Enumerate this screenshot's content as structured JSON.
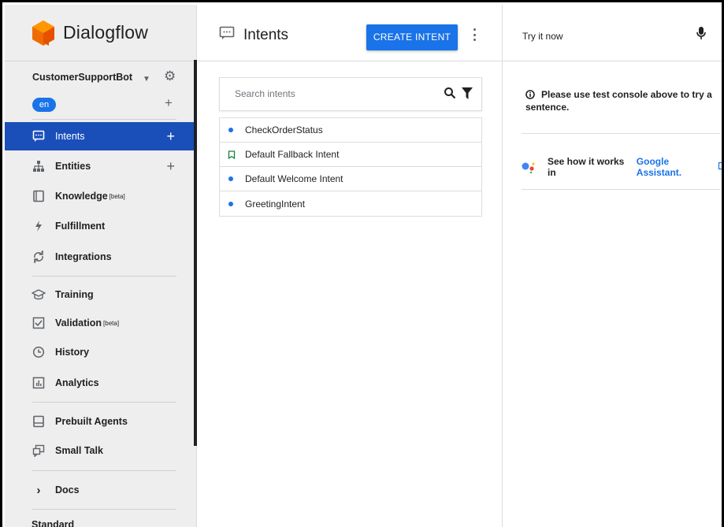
{
  "app": {
    "name": "Dialogflow"
  },
  "agent": {
    "name": "CustomerSupportBot",
    "language": "en"
  },
  "sidebar": {
    "items": [
      {
        "label": "Intents",
        "active": true,
        "has_add": true
      },
      {
        "label": "Entities",
        "has_add": true
      },
      {
        "label": "Knowledge",
        "badge": "[beta]"
      },
      {
        "label": "Fulfillment"
      },
      {
        "label": "Integrations"
      },
      {
        "label": "Training"
      },
      {
        "label": "Validation",
        "badge": "[beta]"
      },
      {
        "label": "History"
      },
      {
        "label": "Analytics"
      },
      {
        "label": "Prebuilt Agents"
      },
      {
        "label": "Small Talk"
      },
      {
        "label": "Docs"
      },
      {
        "label": "Standard"
      }
    ]
  },
  "main": {
    "title": "Intents",
    "create_button": "CREATE INTENT",
    "search": {
      "placeholder": "Search intents",
      "value": ""
    },
    "intents": [
      {
        "name": "CheckOrderStatus",
        "marker": "dot"
      },
      {
        "name": "Default Fallback Intent",
        "marker": "bookmark"
      },
      {
        "name": "Default Welcome Intent",
        "marker": "dot"
      },
      {
        "name": "GreetingIntent",
        "marker": "dot"
      }
    ]
  },
  "console": {
    "title": "Try it now",
    "info_line1": "Please use test console above to try a",
    "info_line2": "sentence.",
    "assistant_text": "See how it works in",
    "assistant_link": "Google Assistant."
  },
  "colors": {
    "accent": "#1a73e8",
    "active_nav": "#1a4fba",
    "logo_orange": "#ef6c00",
    "sidebar_bg": "#eeeeee"
  },
  "icons": {
    "logo": "dialogflow-logo",
    "settings": "gear-icon",
    "search": "search-icon",
    "filter": "filter-icon",
    "mic": "mic-icon",
    "info": "info-icon",
    "external": "external-link-icon"
  }
}
